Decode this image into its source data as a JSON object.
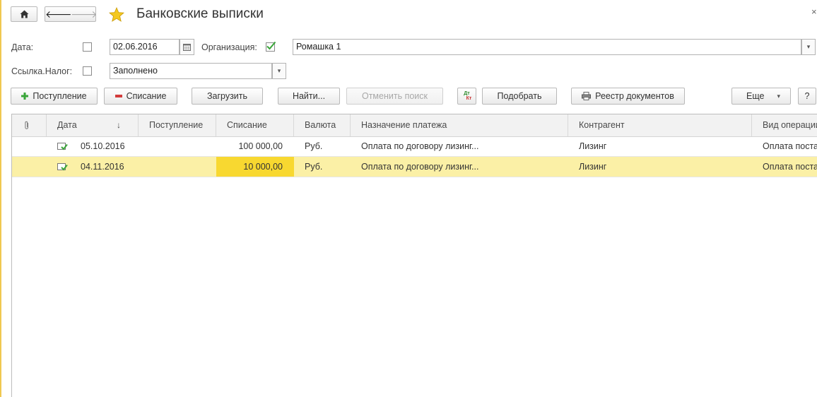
{
  "window": {
    "title": "Банковские выписки",
    "close_glyph": "×"
  },
  "nav": {
    "home_icon": "home-icon",
    "back_glyph": "🡐",
    "forward_glyph": "🡒",
    "favorite_icon": "star-icon"
  },
  "filters": {
    "date_label": "Дата:",
    "date_checked": false,
    "date_value": "02.06.2016",
    "org_label": "Организация:",
    "org_checked": true,
    "org_value": "Ромашка 1",
    "link_label": "Ссылка.Налог:",
    "link_checked": false,
    "link_value": "Заполнено"
  },
  "toolbar": {
    "receipt_label": "Поступление",
    "writeoff_label": "Списание",
    "load_label": "Загрузить",
    "find_label": "Найти...",
    "cancel_search_label": "Отменить поиск",
    "dtkt_top": "Дт",
    "dtkt_bottom": "Кт",
    "pick_label": "Подобрать",
    "registry_label": "Реестр документов",
    "more_label": "Еще",
    "help_label": "?"
  },
  "table": {
    "columns": [
      "",
      "Дата",
      "Поступление",
      "Списание",
      "Валюта",
      "Назначение платежа",
      "Контрагент",
      "Вид операции"
    ],
    "sort_glyph": "↓",
    "rows": [
      {
        "date": "05.10.2016",
        "receipt": "",
        "writeoff": "100 000,00",
        "currency": "Руб.",
        "purpose": "Оплата по договору лизинг...",
        "counterparty": "Лизинг",
        "operation": "Оплата поставщику",
        "selected": false
      },
      {
        "date": "04.11.2016",
        "receipt": "",
        "writeoff": "10 000,00",
        "currency": "Руб.",
        "purpose": "Оплата по договору лизинг...",
        "counterparty": "Лизинг",
        "operation": "Оплата поставщику",
        "selected": true
      }
    ]
  },
  "colors": {
    "accent_yellow": "#f8d830",
    "selection": "#fbf0a6",
    "green_check": "#3aa63a",
    "red_minus": "#d33c3c",
    "green_plus": "#3aa63a"
  }
}
